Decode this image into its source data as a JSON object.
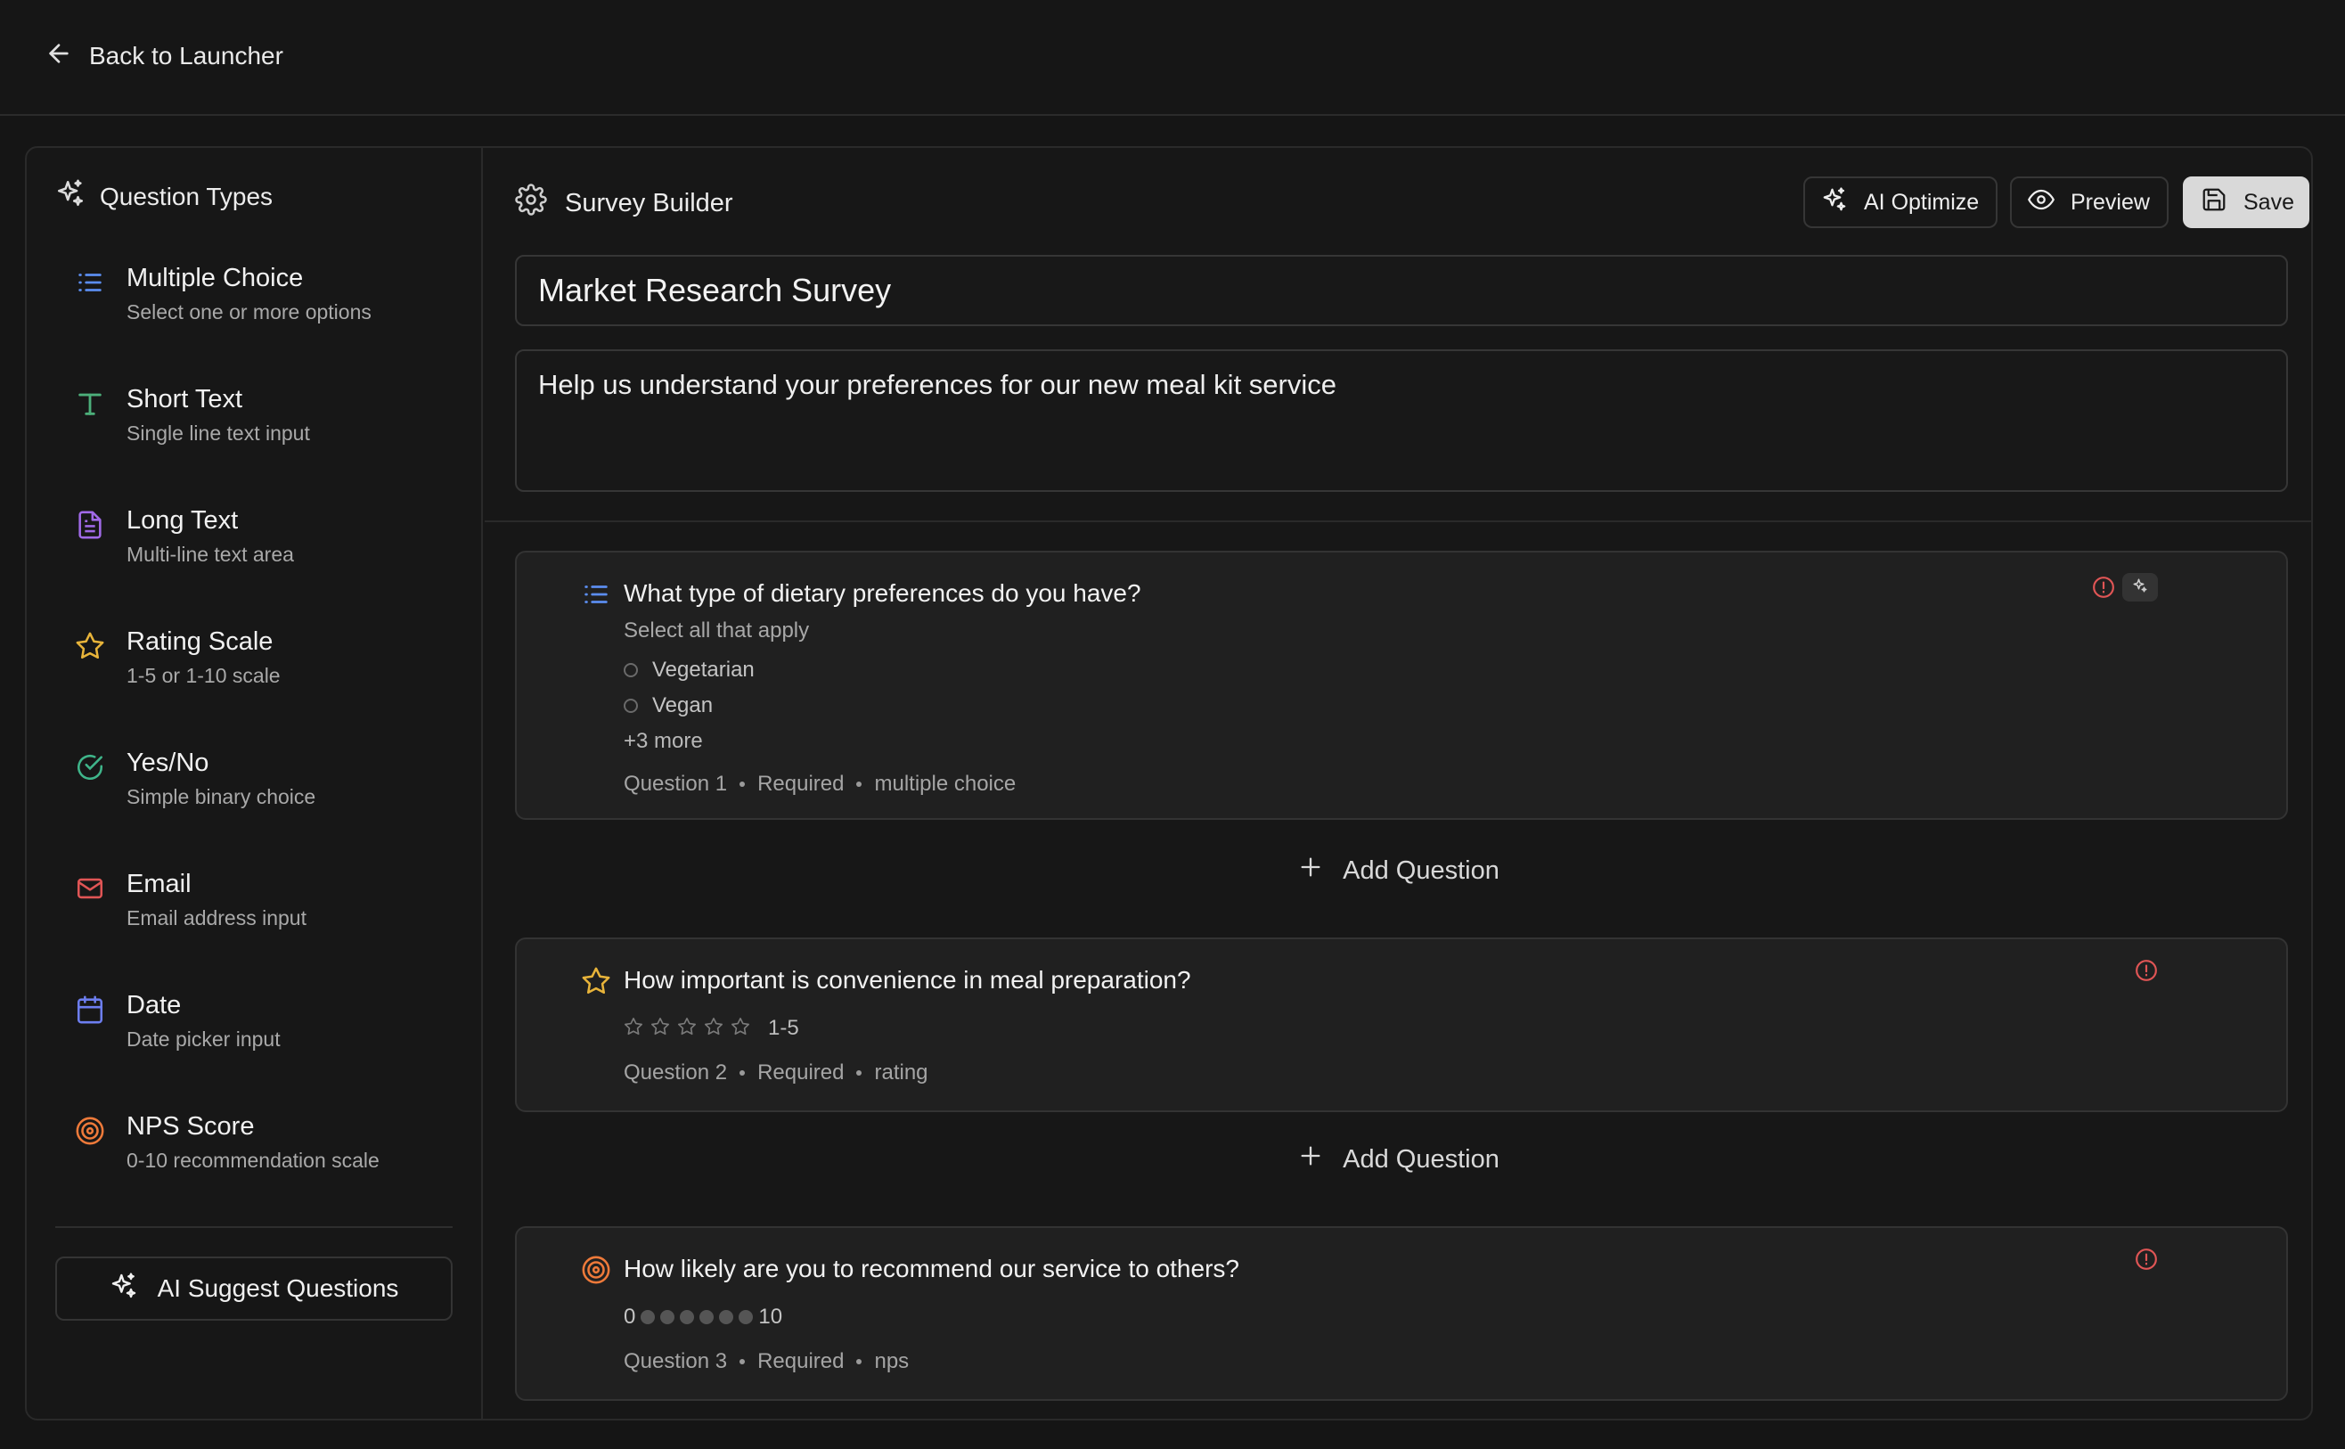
{
  "topbar": {
    "back_label": "Back to Launcher"
  },
  "sidebar": {
    "header": "Question Types",
    "types": [
      {
        "title": "Multiple Choice",
        "desc": "Select one or more options",
        "icon": "list-icon",
        "color": "#5b8def"
      },
      {
        "title": "Short Text",
        "desc": "Single line text input",
        "icon": "text-icon",
        "color": "#4caf7a"
      },
      {
        "title": "Long Text",
        "desc": "Multi-line text area",
        "icon": "document-icon",
        "color": "#a16ae8"
      },
      {
        "title": "Rating Scale",
        "desc": "1-5 or 1-10 scale",
        "icon": "star-icon",
        "color": "#e8b43a"
      },
      {
        "title": "Yes/No",
        "desc": "Simple binary choice",
        "icon": "check-circle-icon",
        "color": "#3fb58a"
      },
      {
        "title": "Email",
        "desc": "Email address input",
        "icon": "mail-icon",
        "color": "#e05555"
      },
      {
        "title": "Date",
        "desc": "Date picker input",
        "icon": "calendar-icon",
        "color": "#6d7ef0"
      },
      {
        "title": "NPS Score",
        "desc": "0-10 recommendation scale",
        "icon": "target-icon",
        "color": "#ee7a3a"
      }
    ],
    "ai_suggest_label": "AI Suggest Questions"
  },
  "builder": {
    "title": "Survey Builder",
    "ai_optimize_label": "AI Optimize",
    "preview_label": "Preview",
    "save_label": "Save",
    "survey_title": "Market Research Survey",
    "survey_description": "Help us understand your preferences for our new meal kit service"
  },
  "questions": [
    {
      "title": "What type of dietary preferences do you have?",
      "subtitle": "Select all that apply",
      "options": [
        "Vegetarian",
        "Vegan"
      ],
      "more": "+3 more",
      "meta_number": "Question 1",
      "meta_required": "Required",
      "meta_type": "multiple choice"
    },
    {
      "title": "How important is convenience in meal preparation?",
      "scale": "1-5",
      "star_count": 5,
      "meta_number": "Question 2",
      "meta_required": "Required",
      "meta_type": "rating"
    },
    {
      "title": "How likely are you to recommend our service to others?",
      "nps_min": "0",
      "nps_max": "10",
      "meta_number": "Question 3",
      "meta_required": "Required",
      "meta_type": "nps"
    }
  ],
  "add_question_label": "Add Question",
  "colors": {
    "warning": "#e05555",
    "background": "#151515",
    "card": "#202020"
  }
}
